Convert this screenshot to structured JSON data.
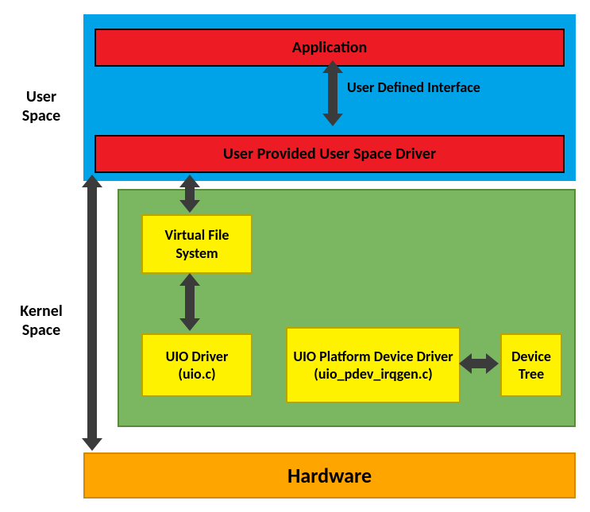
{
  "labels": {
    "user_space": "User Space",
    "kernel_space": "Kernel Space",
    "user_defined_interface": "User Defined Interface"
  },
  "user_space": {
    "application": "Application",
    "user_space_driver": "User Provided User Space Driver"
  },
  "kernel_space": {
    "vfs": "Virtual File System",
    "uio_driver": "UIO Driver (uio.c)",
    "uio_platform_driver": "UIO Platform Device Driver (uio_pdev_irqgen.c)",
    "device_tree": "Device Tree"
  },
  "hardware": "Hardware",
  "colors": {
    "user_space_bg": "#00a2e8",
    "kernel_space_bg": "#7bb661",
    "app_bg": "#ed1c24",
    "kernel_component_bg": "#fff200",
    "hardware_bg": "#ffa500",
    "arrow": "#3b3b3b"
  }
}
